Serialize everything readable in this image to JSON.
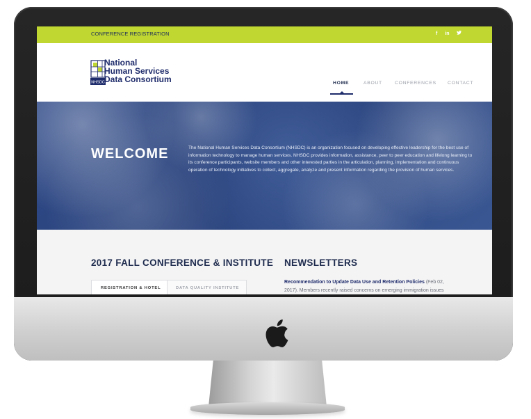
{
  "topbar": {
    "conference_link": "CONFERENCE REGISTRATION",
    "social": [
      "f",
      "in",
      "¥"
    ]
  },
  "logo": {
    "badge": "NHSDC",
    "line1": "National",
    "line2": "Human Services",
    "line3": "Data Consortium"
  },
  "nav": {
    "items": [
      "HOME",
      "ABOUT",
      "CONFERENCES",
      "CONTACT"
    ],
    "active": "HOME"
  },
  "hero": {
    "title": "WELCOME",
    "text": "The National Human Services Data Consortium (NHSDC) is an organization focused on developing effective leadership for the best use of information technology to manage human services. NHSDC provides information, assistance, peer to peer education and lifelong learning to its conference participants, website members and other interested parties in the articulation, planning, implementation and continuous operation of technology initiatives to collect, aggregate, analyze and present information regarding the provision of human services."
  },
  "conference": {
    "heading": "2017 FALL CONFERENCE & INSTITUTE",
    "tabs": [
      "REGISTRATION & HOTEL",
      "DATA QUALITY INSTITUTE"
    ]
  },
  "newsletters": {
    "heading": "NEWSLETTERS",
    "item_title": "Recommendation to Update Data Use and Retention Policies",
    "item_date": "(Feb 02,",
    "item_line2": "2017). Members recently raised concerns on emerging immigration issues"
  },
  "colors": {
    "accent_green": "#bfd730",
    "navy": "#1f2c6b",
    "hero_blue": "#2f4a88"
  }
}
